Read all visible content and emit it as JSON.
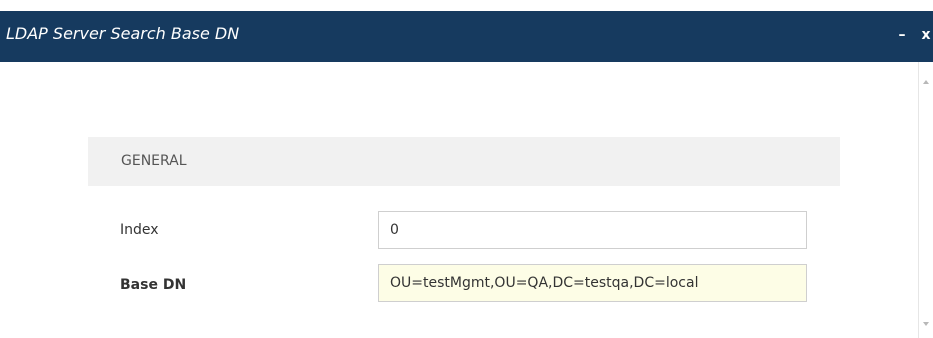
{
  "window": {
    "title": "LDAP Server Search Base DN",
    "minimize_label": "–",
    "close_label": "x"
  },
  "section": {
    "title": "GENERAL"
  },
  "fields": {
    "index": {
      "label": "Index",
      "value": "0"
    },
    "base_dn": {
      "label": "Base DN",
      "value": "OU=testMgmt,OU=QA,DC=testqa,DC=local"
    }
  },
  "colors": {
    "titlebar": "#163a5f",
    "section_header_bg": "#f1f1f1",
    "modified_field_bg": "#fdfde6"
  },
  "icons": {
    "scroll_up": "triangle-up",
    "scroll_down": "triangle-down"
  }
}
